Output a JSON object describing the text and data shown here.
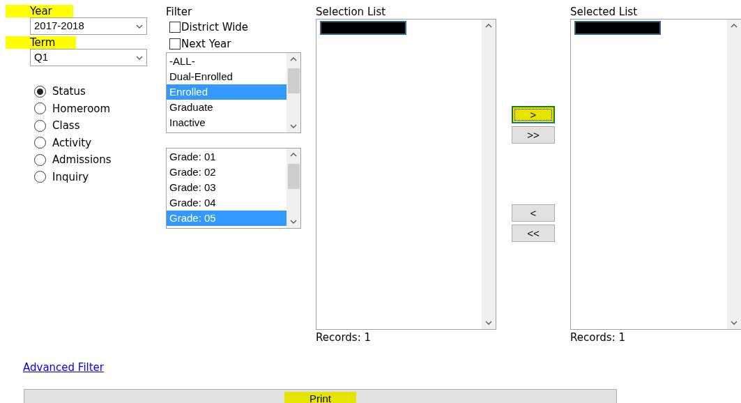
{
  "year": {
    "label": "Year",
    "highlighted": true,
    "value": "2017-2018"
  },
  "term": {
    "label": "Term",
    "highlighted": true,
    "value": "Q1"
  },
  "report_by": [
    {
      "label": "Status",
      "selected": true
    },
    {
      "label": "Homeroom",
      "selected": false
    },
    {
      "label": "Class",
      "selected": false
    },
    {
      "label": "Activity",
      "selected": false
    },
    {
      "label": "Admissions",
      "selected": false
    },
    {
      "label": "Inquiry",
      "selected": false
    }
  ],
  "filter": {
    "label": "Filter",
    "checkboxes": [
      {
        "label": "District Wide",
        "checked": false
      },
      {
        "label": "Next Year",
        "checked": false
      }
    ],
    "status_list": [
      {
        "label": "-ALL-",
        "selected": false
      },
      {
        "label": "Dual-Enrolled",
        "selected": false
      },
      {
        "label": "Enrolled",
        "selected": true
      },
      {
        "label": "Graduate",
        "selected": false
      },
      {
        "label": "Inactive",
        "selected": false
      }
    ],
    "grade_list": [
      {
        "label": "Grade: 01",
        "selected": false
      },
      {
        "label": "Grade: 02",
        "selected": false
      },
      {
        "label": "Grade: 03",
        "selected": false
      },
      {
        "label": "Grade: 04",
        "selected": false
      },
      {
        "label": "Grade: 05",
        "selected": true
      }
    ]
  },
  "selection_list": {
    "label": "Selection List",
    "items": [
      {
        "kind": "redacted"
      }
    ],
    "records": "Records: 1"
  },
  "add_buttons": [
    {
      "label": ">",
      "highlighted": true,
      "focused": true
    },
    {
      "label": ">>",
      "highlighted": false,
      "focused": false
    }
  ],
  "remove_buttons": [
    {
      "label": "<",
      "highlighted": false,
      "focused": false
    },
    {
      "label": "<<",
      "highlighted": false,
      "focused": false
    }
  ],
  "selected_list": {
    "label": "Selected List",
    "items": [
      {
        "kind": "redacted"
      }
    ],
    "records": "Records: 1"
  },
  "advanced_filter_link": "Advanced Filter",
  "print_button": {
    "label": "Print",
    "highlighted": true
  }
}
